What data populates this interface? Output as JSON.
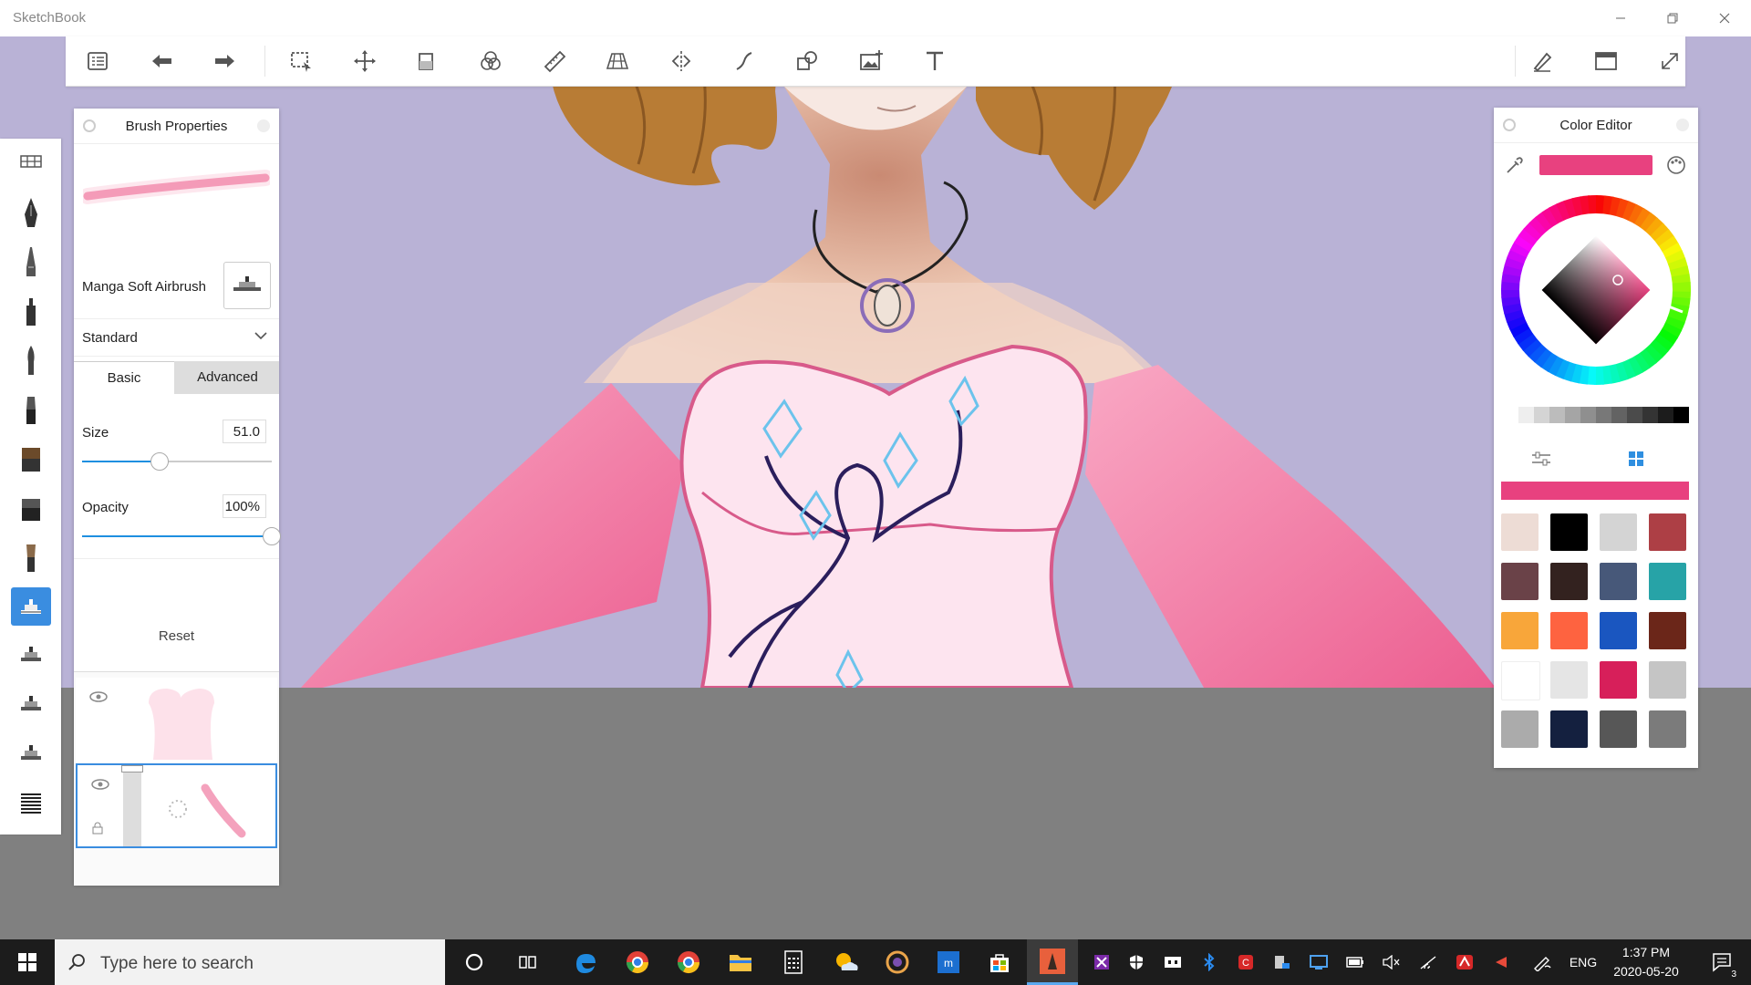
{
  "app": {
    "title": "SketchBook"
  },
  "toolbar": {
    "tools": [
      "lagoon-menu",
      "undo",
      "redo",
      "selection",
      "transform",
      "fill",
      "copic-color",
      "ruler",
      "perspective",
      "symmetry",
      "stroke",
      "shapes",
      "import-image",
      "text"
    ],
    "right_tools": [
      "brush-toggle",
      "window-toggle",
      "fullscreen"
    ]
  },
  "brush_palette": {
    "items": [
      "brush-library",
      "ballpoint-pen",
      "technical-pen",
      "marker",
      "paintbrush",
      "ink-brush",
      "flat-brush",
      "wide-brush",
      "round-brush",
      "manga-soft-airbrush",
      "airbrush-2",
      "airbrush-3",
      "airbrush-4",
      "hatch-brush"
    ],
    "selected_index": 9
  },
  "brush_properties": {
    "title": "Brush Properties",
    "brush_name": "Manga Soft Airbrush",
    "blend_mode": "Standard",
    "tabs": {
      "basic": "Basic",
      "advanced": "Advanced"
    },
    "size": {
      "label": "Size",
      "value": "51.0",
      "fraction": 0.41
    },
    "opacity": {
      "label": "Opacity",
      "value": "100%",
      "fraction": 1.0
    },
    "reset_label": "Reset"
  },
  "color_editor": {
    "title": "Color Editor",
    "current_color": "#e8417f",
    "grays": [
      "#ffffff",
      "#eeeeee",
      "#d4d4d4",
      "#bcbcbc",
      "#a5a5a5",
      "#8f8f8f",
      "#787878",
      "#636363",
      "#4b4b4b",
      "#343434",
      "#1c1c1c",
      "#000000"
    ],
    "swatches": [
      "#eddcd5",
      "#000000",
      "#d4d4d4",
      "#ad3f45",
      "#6a4248",
      "#33221f",
      "#475879",
      "#27a3a7",
      "#f8a63a",
      "#fe6340",
      "#1a56c0",
      "#6b2619",
      "#ffffff",
      "#e5e5e5",
      "#d71f5a",
      "#c5c5c5",
      "#ababab",
      "#14203f",
      "#575757",
      "#7b7b7b"
    ]
  },
  "taskbar": {
    "search_placeholder": "Type here to search",
    "language": "ENG",
    "time": "1:37 PM",
    "date": "2020-05-20",
    "notifications": "3"
  }
}
